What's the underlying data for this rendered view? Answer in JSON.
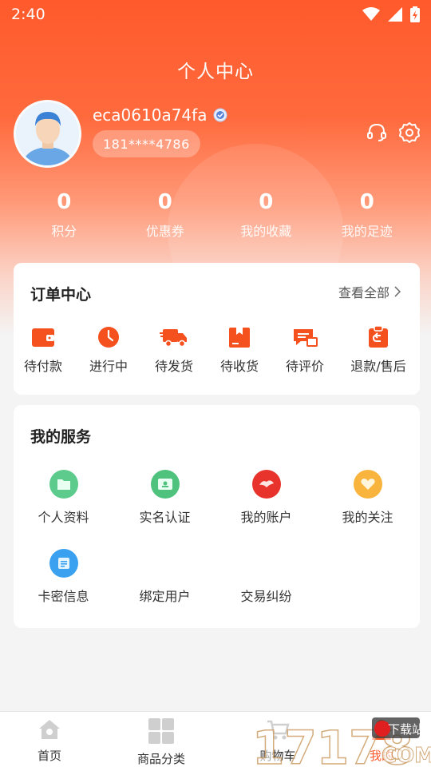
{
  "status_bar": {
    "time": "2:40"
  },
  "header": {
    "title": "个人中心"
  },
  "profile": {
    "username": "eca0610a74fa",
    "phone": "181****4786"
  },
  "stats": [
    {
      "value": "0",
      "label": "积分"
    },
    {
      "value": "0",
      "label": "优惠券"
    },
    {
      "value": "0",
      "label": "我的收藏"
    },
    {
      "value": "0",
      "label": "我的足迹"
    }
  ],
  "orders": {
    "title": "订单中心",
    "view_all": "查看全部",
    "items": [
      {
        "label": "待付款",
        "icon": "wallet-icon"
      },
      {
        "label": "进行中",
        "icon": "clock-icon"
      },
      {
        "label": "待发货",
        "icon": "truck-icon"
      },
      {
        "label": "待收货",
        "icon": "package-icon"
      },
      {
        "label": "待评价",
        "icon": "review-icon"
      },
      {
        "label": "退款/售后",
        "icon": "refund-icon"
      }
    ]
  },
  "services": {
    "title": "我的服务",
    "items": [
      {
        "label": "个人资料",
        "icon": "folder-icon"
      },
      {
        "label": "实名认证",
        "icon": "id-card-icon"
      },
      {
        "label": "我的账户",
        "icon": "account-icon"
      },
      {
        "label": "我的关注",
        "icon": "heart-icon"
      },
      {
        "label": "卡密信息",
        "icon": "card-info-icon"
      },
      {
        "label": "绑定用户"
      },
      {
        "label": "交易纠纷"
      }
    ]
  },
  "tabbar": [
    {
      "label": "首页",
      "icon": "home-icon"
    },
    {
      "label": "商品分类",
      "icon": "category-icon"
    },
    {
      "label": "购物车",
      "icon": "cart-icon"
    },
    {
      "label": "我的",
      "icon": "profile-icon"
    }
  ],
  "watermark": {
    "text": "17178",
    "tag": "下载站",
    "suffix": "COM"
  },
  "colors": {
    "accent": "#ff5a2c",
    "order_icon": "#f4511e"
  }
}
